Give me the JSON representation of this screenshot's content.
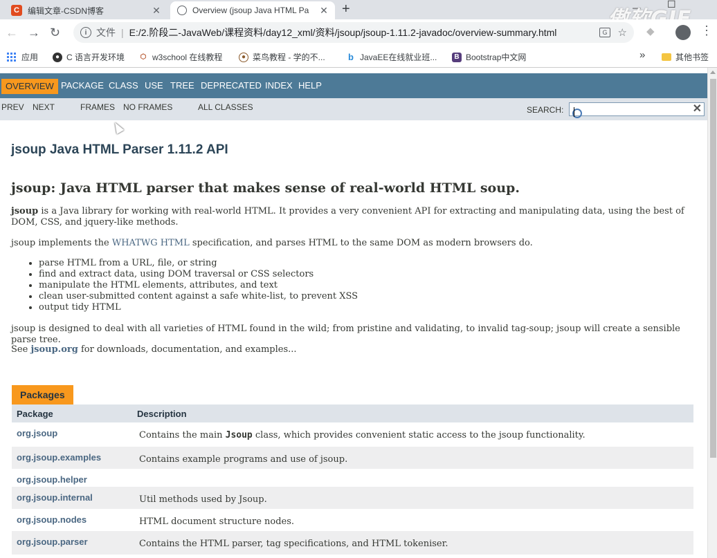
{
  "browser": {
    "tabs": [
      {
        "title": "编辑文章-CSDN博客",
        "fav": "C"
      },
      {
        "title": "Overview (jsoup Java HTML Pa"
      }
    ],
    "new_tab": "+",
    "watermark": "傲软GIF",
    "address": {
      "scheme": "文件",
      "url": "E:/2.阶段二-JavaWeb/课程资料/day12_xml/资料/jsoup/jsoup-1.11.2-javadoc/overview-summary.html"
    },
    "bookmarks": [
      {
        "label": "应用",
        "icon": "apps-icon"
      },
      {
        "label": "C 语言开发环境",
        "icon": "github-icon"
      },
      {
        "label": "w3school 在线教程",
        "icon": "w3school-icon"
      },
      {
        "label": "菜鸟教程 - 学的不...",
        "icon": "runoob-icon"
      },
      {
        "label": "JavaEE在线就业班...",
        "icon": "bilibili-icon"
      },
      {
        "label": "Bootstrap中文网",
        "icon": "bootstrap-icon"
      }
    ],
    "more": "»",
    "other_bookmarks": "其他书签"
  },
  "javadoc": {
    "topnav": [
      "OVERVIEW",
      "PACKAGE",
      "CLASS",
      "USE",
      "TREE",
      "DEPRECATED",
      "INDEX",
      "HELP"
    ],
    "subnav": [
      "PREV",
      "NEXT",
      "FRAMES",
      "NO FRAMES",
      "ALL CLASSES"
    ],
    "search_label": "SEARCH:",
    "page_title": "jsoup Java HTML Parser 1.11.2 API",
    "subtitle": "jsoup: Java HTML parser that makes sense of real-world HTML soup.",
    "intro": {
      "bold": "jsoup",
      "rest": " is a Java library for working with real-world HTML. It provides a very convenient API for extracting and manipulating data, using the best of DOM, CSS, and jquery-like methods."
    },
    "implements": {
      "before": "jsoup implements the ",
      "link": "WHATWG HTML",
      "after": " specification, and parses HTML to the same DOM as modern browsers do."
    },
    "features": [
      "parse HTML from a URL, file, or string",
      "find and extract data, using DOM traversal or CSS selectors",
      "manipulate the HTML elements, attributes, and text",
      "clean user-submitted content against a safe white-list, to prevent XSS",
      "output tidy HTML"
    ],
    "designed": "jsoup is designed to deal with all varieties of HTML found in the wild; from pristine and validating, to invalid tag-soup; jsoup will create a sensible parse tree.",
    "see": {
      "before": "See ",
      "link": "jsoup.org",
      "after": " for downloads, documentation, and examples..."
    },
    "packages_caption": "Packages",
    "table_headers": [
      "Package",
      "Description"
    ],
    "packages": [
      {
        "name": "org.jsoup",
        "desc_pre": "Contains the main ",
        "desc_code": "Jsoup",
        "desc_post": " class, which provides convenient static access to the jsoup functionality."
      },
      {
        "name": "org.jsoup.examples",
        "desc_pre": "Contains example programs and use of jsoup.",
        "desc_code": "",
        "desc_post": ""
      },
      {
        "name": "org.jsoup.helper",
        "desc_pre": "",
        "desc_code": "",
        "desc_post": ""
      },
      {
        "name": "org.jsoup.internal",
        "desc_pre": "Util methods used by Jsoup.",
        "desc_code": "",
        "desc_post": ""
      },
      {
        "name": "org.jsoup.nodes",
        "desc_pre": "HTML document structure nodes.",
        "desc_code": "",
        "desc_post": ""
      },
      {
        "name": "org.jsoup.parser",
        "desc_pre": "Contains the HTML parser, tag specifications, and HTML tokeniser.",
        "desc_code": "",
        "desc_post": ""
      }
    ]
  }
}
